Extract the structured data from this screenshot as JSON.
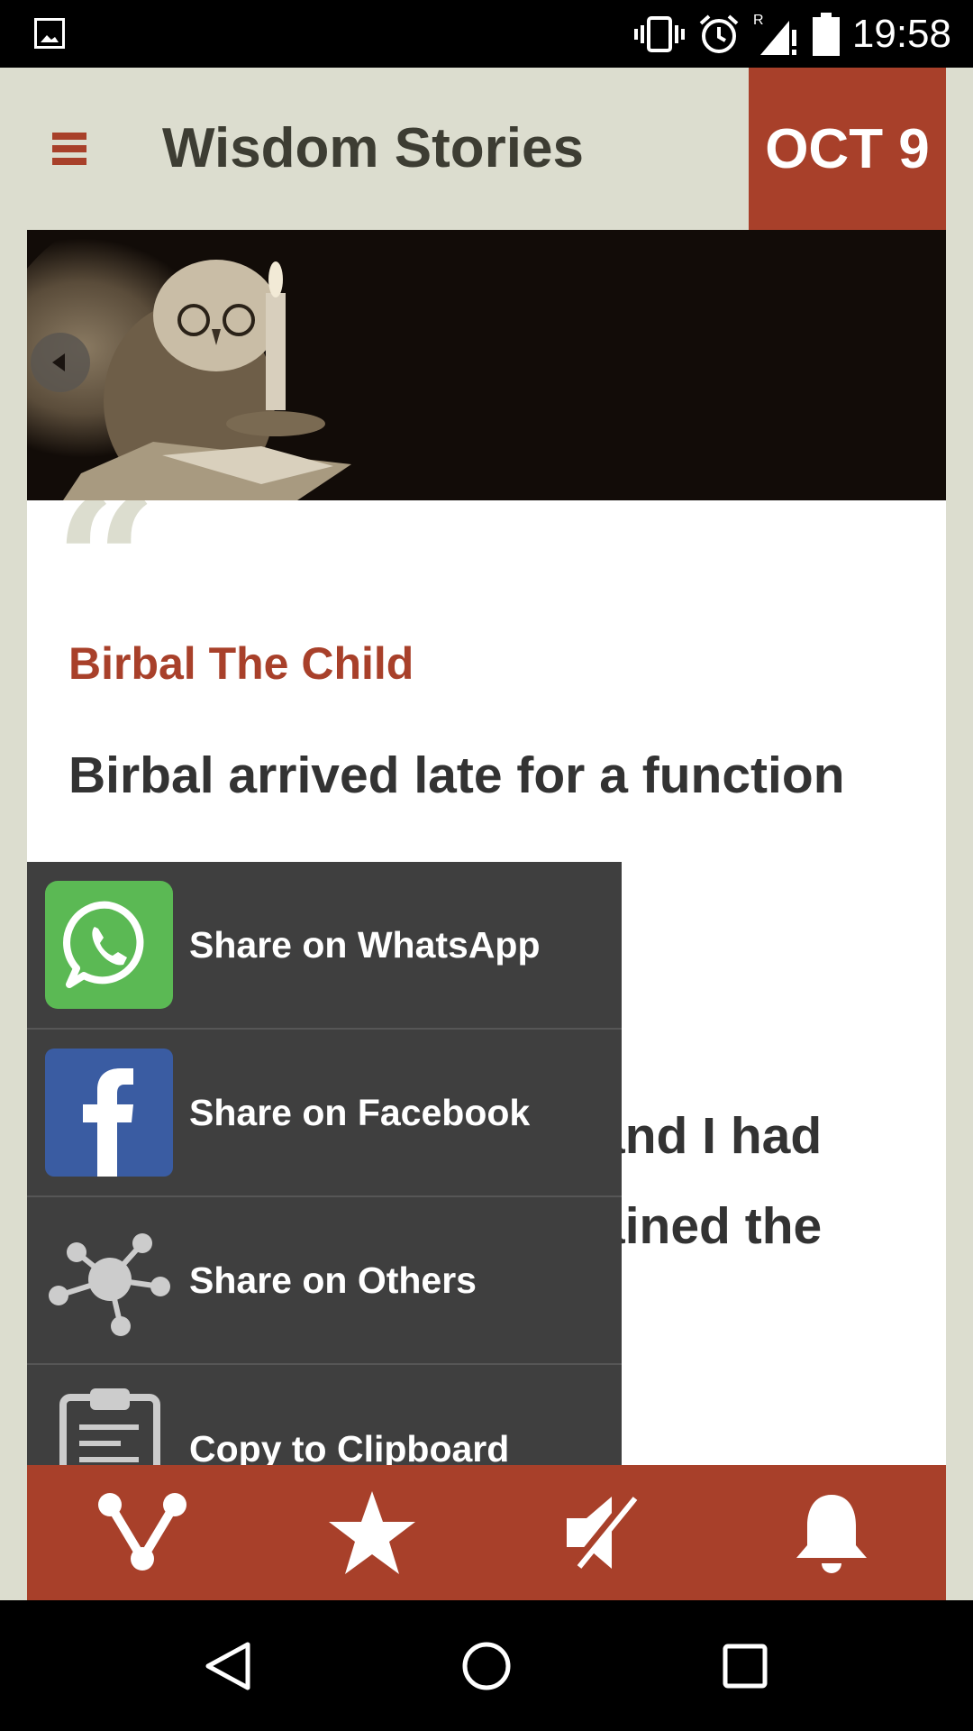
{
  "status_bar": {
    "time": "19:58",
    "icons": [
      "gallery-icon",
      "vibrate-icon",
      "alarm-icon",
      "signal-roaming-icon",
      "battery-icon"
    ]
  },
  "header": {
    "menu_icon": "hamburger-menu-icon",
    "title": "Wisdom Stories",
    "date": "OCT 9"
  },
  "banner": {
    "image": "owl-with-candle-illustration",
    "prev_icon": "chevron-left-icon"
  },
  "story": {
    "title": "Birbal The Child",
    "text_visible_top": "Birbal arrived late for a function",
    "text_fragment_1": "and I had",
    "text_fragment_2": "ained the"
  },
  "share_menu": {
    "items": [
      {
        "label": "Share on WhatsApp",
        "icon": "whatsapp-icon"
      },
      {
        "label": "Share on Facebook",
        "icon": "facebook-icon"
      },
      {
        "label": "Share on Others",
        "icon": "share-others-icon"
      },
      {
        "label": "Copy to Clipboard",
        "icon": "clipboard-icon"
      }
    ]
  },
  "bottom_bar": {
    "buttons": [
      "share-icon",
      "star-icon",
      "mute-icon",
      "bell-icon"
    ]
  },
  "nav_bar": {
    "buttons": [
      "back-icon",
      "home-icon",
      "recents-icon"
    ]
  },
  "colors": {
    "accent": "#a8402a",
    "background": "#dcddcf",
    "menu_bg": "#3f3f3f",
    "whatsapp": "#5bb954",
    "facebook": "#3a5ca2"
  }
}
